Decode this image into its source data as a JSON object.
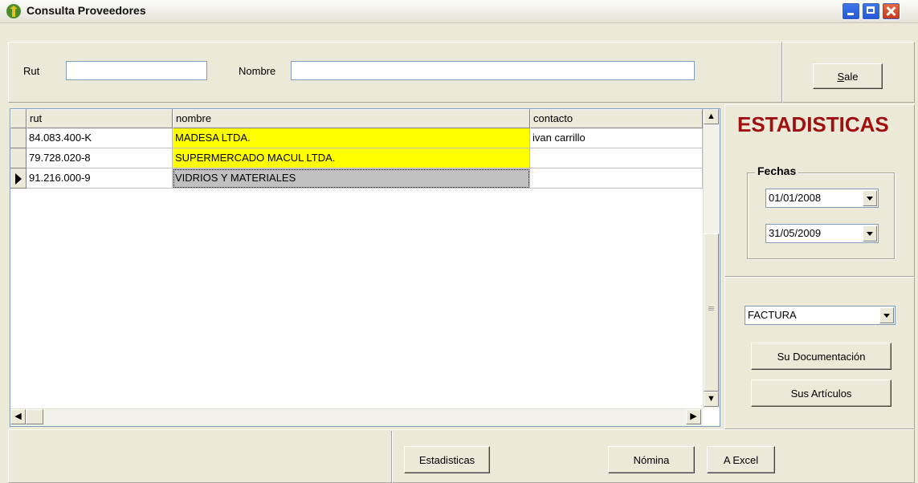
{
  "window": {
    "title": "Consulta Proveedores"
  },
  "search": {
    "rut_label": "Rut",
    "rut_value": "",
    "nombre_label": "Nombre",
    "nombre_value": ""
  },
  "toolbar": {
    "sale_label": "Sale"
  },
  "grid": {
    "columns": [
      "rut",
      "nombre",
      "contacto"
    ],
    "rows": [
      {
        "rut": "84.083.400-K",
        "nombre": "MADESA LTDA.",
        "contacto": "ivan carrillo"
      },
      {
        "rut": "79.728.020-8",
        "nombre": "SUPERMERCADO MACUL LTDA.",
        "contacto": ""
      },
      {
        "rut": "91.216.000-9",
        "nombre": "VIDRIOS Y MATERIALES",
        "contacto": ""
      }
    ]
  },
  "stats": {
    "title": "ESTADISTICAS",
    "fechas_label": "Fechas",
    "fecha_desde": "01/01/2008",
    "fecha_hasta": "31/05/2009",
    "doc_type": "FACTURA",
    "su_documentacion_label": "Su Documentación",
    "sus_articulos_label": "Sus Artículos"
  },
  "bottom": {
    "estadisticas_label": "Estadisticas",
    "nomina_label": "Nómina",
    "excel_label": "A Excel"
  },
  "colors": {
    "highlight": "#ffff00",
    "stat_title": "#a01010",
    "selected": "#c0c0c0"
  },
  "icons": {
    "app": "app-icon",
    "minimize": "minimize-icon",
    "maximize": "maximize-icon",
    "close": "close-icon"
  }
}
